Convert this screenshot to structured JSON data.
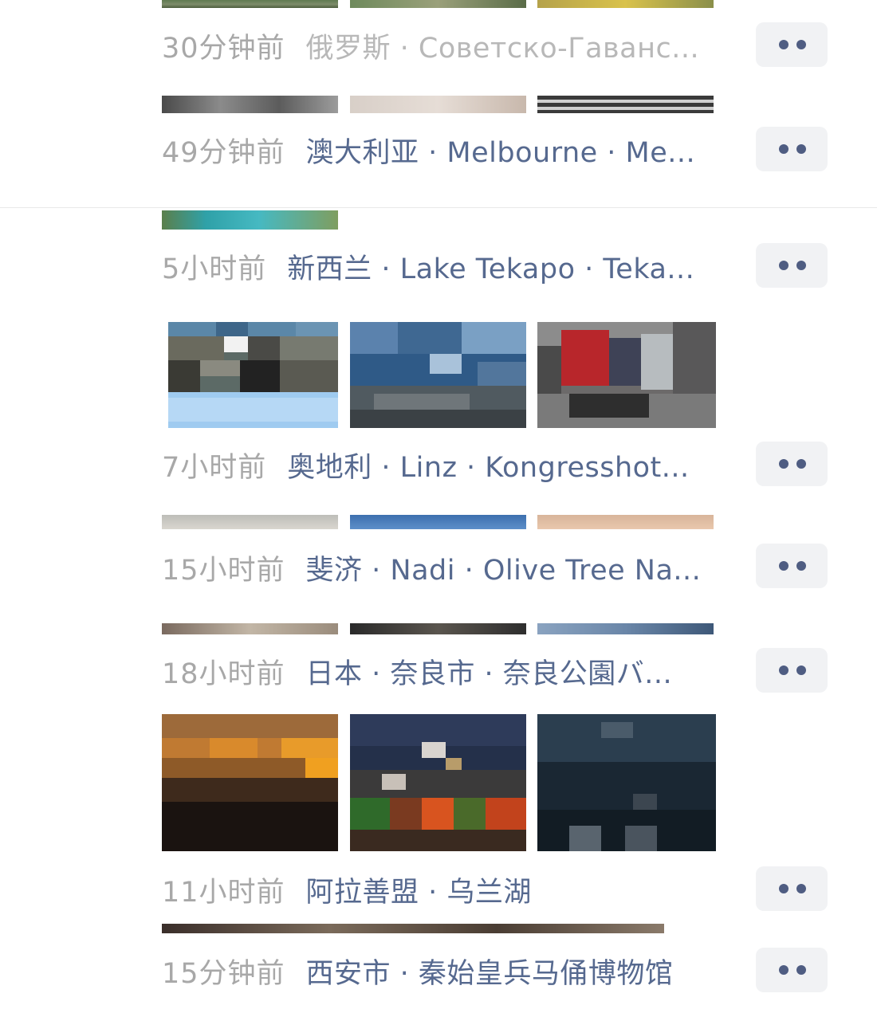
{
  "feed": [
    {
      "time": "30分钟前",
      "location": "俄罗斯 · Советско-Гаванс...",
      "location_style": "muted"
    },
    {
      "time": "49分钟前",
      "location": "澳大利亚 · Melbourne · Me...",
      "location_style": "link"
    },
    {
      "time": "5小时前",
      "location": "新西兰 · Lake Tekapo · Teka...",
      "location_style": "link"
    },
    {
      "time": "7小时前",
      "location": "奥地利 · Linz · Kongresshot...",
      "location_style": "link"
    },
    {
      "time": "15小时前",
      "location": "斐济 · Nadi · Olive Tree Na...",
      "location_style": "link"
    },
    {
      "time": "18小时前",
      "location": "日本 · 奈良市 · 奈良公園バ...",
      "location_style": "link"
    },
    {
      "time": "11小时前",
      "location": "阿拉善盟 · 乌兰湖",
      "location_style": "link"
    },
    {
      "time": "15分钟前",
      "location": "西安市 · 秦始皇兵马俑博物馆",
      "location_style": "link"
    }
  ],
  "colors": {
    "time_text": "#a8a8a8",
    "location_link": "#56698f",
    "location_muted": "#b8b8b8",
    "more_button_bg": "#f1f2f4",
    "more_button_dots": "#4f5d82"
  },
  "icons": {
    "more_button": "two-dots-more-icon",
    "thumbnail": "pixelated-photo-thumbnail"
  }
}
